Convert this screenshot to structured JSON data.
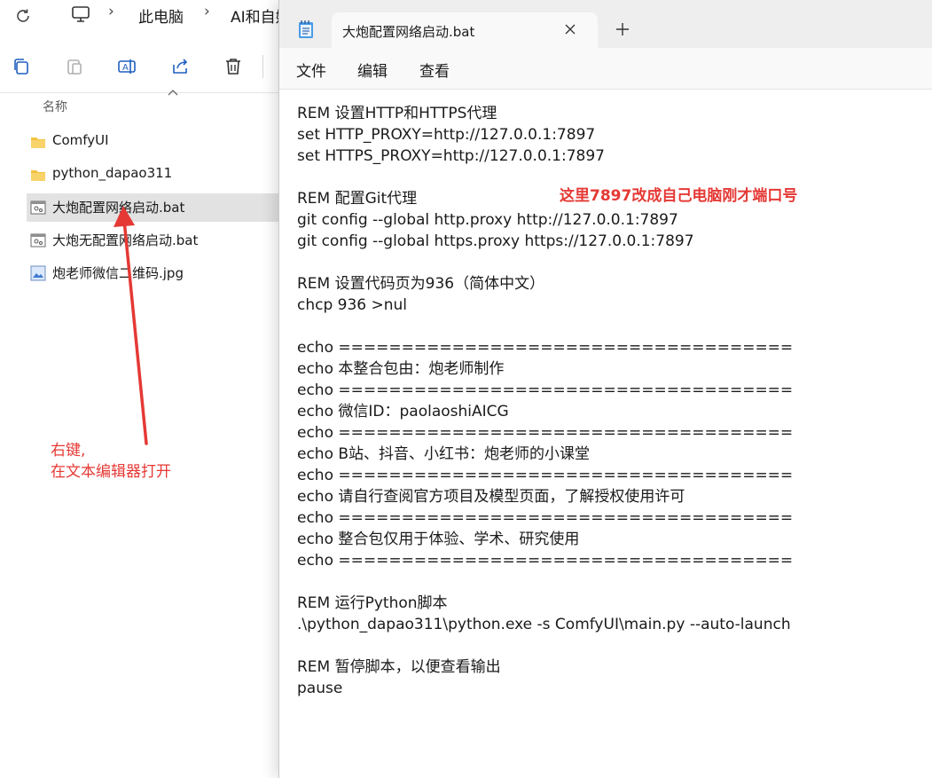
{
  "explorer": {
    "breadcrumb": [
      "此电脑",
      "AI和自媒"
    ],
    "column_header": "名称",
    "files": [
      {
        "name": "ComfyUI",
        "type": "folder",
        "selected": false
      },
      {
        "name": "python_dapao311",
        "type": "folder",
        "selected": false
      },
      {
        "name": "大炮配置网络启动.bat",
        "type": "bat",
        "selected": true
      },
      {
        "name": "大炮无配置网络启动.bat",
        "type": "bat",
        "selected": false
      },
      {
        "name": "炮老师微信二维码.jpg",
        "type": "jpg",
        "selected": false
      }
    ],
    "toolbar_icons": [
      "copy-icon",
      "paste-icon",
      "rename-icon",
      "share-icon",
      "delete-icon"
    ]
  },
  "annotation": {
    "left_note": [
      "右键,",
      "在文本编辑器打开"
    ],
    "right_note": "这里7897改成自己电脑刚才端口号",
    "color": "#e53935"
  },
  "notepad": {
    "tab_title": "大炮配置网络启动.bat",
    "menu": [
      "文件",
      "编辑",
      "查看"
    ],
    "lines": [
      "REM 设置HTTP和HTTPS代理",
      "set HTTP_PROXY=http://127.0.0.1:7897",
      "set HTTPS_PROXY=http://127.0.0.1:7897",
      "",
      "REM 配置Git代理",
      "git config --global http.proxy http://127.0.0.1:7897",
      "git config --global https.proxy https://127.0.0.1:7897",
      "",
      "REM 设置代码页为936（简体中文）",
      "chcp 936 >nul",
      "",
      "echo ====================================",
      "echo 本整合包由：炮老师制作",
      "echo ====================================",
      "echo 微信ID：paolaoshiAICG",
      "echo ====================================",
      "echo B站、抖音、小红书：炮老师的小课堂",
      "echo ====================================",
      "echo 请自行查阅官方项目及模型页面，了解授权使用许可",
      "echo ====================================",
      "echo 整合包仅用于体验、学术、研究使用",
      "echo ====================================",
      "",
      "REM 运行Python脚本",
      ".\\python_dapao311\\python.exe -s ComfyUI\\main.py --auto-launch",
      "",
      "REM 暂停脚本，以便查看输出",
      "pause"
    ]
  }
}
